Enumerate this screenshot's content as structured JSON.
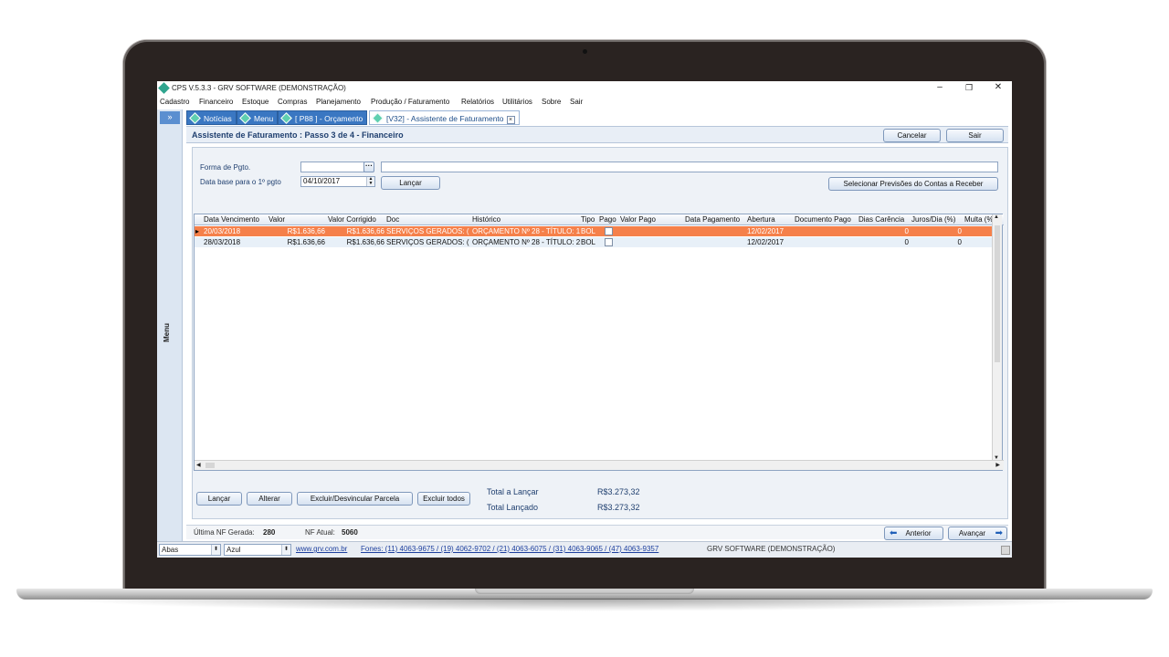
{
  "window": {
    "title": "CPS V.5.3.3 - GRV SOFTWARE (DEMONSTRAÇÃO)",
    "minimize": "–",
    "restore": "❐",
    "close": "✕"
  },
  "menu": [
    "Cadastro",
    "Financeiro",
    "Estoque",
    "Compras",
    "Planejamento",
    "Produção / Faturamento",
    "Relatórios",
    "Utilitários",
    "Sobre",
    "Sair"
  ],
  "sidebar": {
    "toggle": "»",
    "label": "Menu"
  },
  "tabs": [
    {
      "label": "Notícias"
    },
    {
      "label": "Menu"
    },
    {
      "label": "[ P88 ] - Orçamento"
    },
    {
      "label": "[V32] - Assistente de Faturamento"
    }
  ],
  "header": {
    "title": "Assistente de Faturamento : Passo 3 de 4 - Financeiro",
    "cancel_label": "Cancelar",
    "exit_label": "Sair"
  },
  "form": {
    "payment_label": "Forma de Pgto.",
    "payment_value": "",
    "payment_desc": "",
    "date_label": "Data base para o 1º pgto",
    "date_value": "04/10/2017",
    "lancar_label": "Lançar",
    "select_forecast_label": "Selecionar Previsões do Contas a Receber"
  },
  "grid": {
    "columns": [
      "Data Vencimento",
      "Valor",
      "Valor Corrigido",
      "Doc",
      "Histórico",
      "Tipo",
      "Pago",
      "Valor Pago",
      "Data Pagamento",
      "Abertura",
      "Documento Pago",
      "Dias Carência",
      "Juros/Dia (%)",
      "Multa (%"
    ],
    "rows": [
      {
        "vencimento": "20/03/2018",
        "valor": "R$1.636,66",
        "corrigido": "R$1.636,66",
        "doc": "SERVIÇOS GERADOS: (",
        "historico": "ORÇAMENTO Nº 28 - TÍTULO: 1",
        "tipo": "BOL",
        "abertura": "12/02/2017",
        "carencia": "0",
        "juros": "0"
      },
      {
        "vencimento": "28/03/2018",
        "valor": "R$1.636,66",
        "corrigido": "R$1.636,66",
        "doc": "SERVIÇOS GERADOS: (",
        "historico": "ORÇAMENTO Nº 28 - TÍTULO: 2",
        "tipo": "BOL",
        "abertura": "12/02/2017",
        "carencia": "0",
        "juros": "0"
      }
    ]
  },
  "actions": {
    "lancar": "Lançar",
    "alterar": "Alterar",
    "excluir_parcela": "Excluir/Desvincular Parcela",
    "excluir_todos": "Excluir todos"
  },
  "totals": {
    "a_lancar_label": "Total a Lançar",
    "a_lancar_value": "R$3.273,32",
    "lancado_label": "Total Lançado",
    "lancado_value": "R$3.273,32"
  },
  "status": {
    "last_nf_label": "Última NF Gerada:",
    "last_nf_value": "280",
    "nf_atual_label": "NF Atual:",
    "nf_atual_value": "5060",
    "anterior_label": "Anterior",
    "avancar_label": "Avançar"
  },
  "bottombar": {
    "tabs_select": "Abas",
    "theme_select": "Azul",
    "website": "www.grv.com.br",
    "phones": "Fones: (11) 4063-9675 / (19) 4062-9702 / (21) 4063-6075 / (31) 4063-9065 / (47) 4063-9357",
    "company": "GRV SOFTWARE (DEMONSTRAÇÃO)"
  },
  "colors": {
    "accent": "#3a77c2",
    "selected_row": "#f5804a",
    "alt_row": "#e8f0f8"
  }
}
